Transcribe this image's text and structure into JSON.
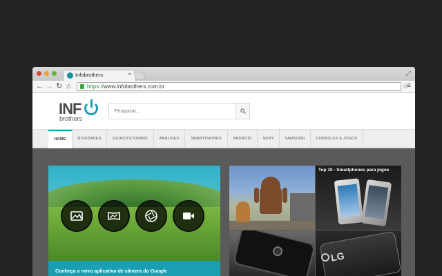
{
  "browser": {
    "tab_title": "Infobrothers",
    "tab_close": "×",
    "url_scheme": "https://",
    "url_rest": "www.infobrothers.com.br"
  },
  "site": {
    "logo_inf": "INF",
    "logo_brothers": "brothers",
    "search_placeholder": "Pesquisar..."
  },
  "nav": {
    "items": [
      {
        "label": "HOME"
      },
      {
        "label": "NOVIDADES"
      },
      {
        "label": "GUIAS/TUTORIAIS"
      },
      {
        "label": "ANÁLISES"
      },
      {
        "label": "SMARTPHONES"
      },
      {
        "label": "ANDROID"
      },
      {
        "label": "SONY"
      },
      {
        "label": "SAMSUNG"
      },
      {
        "label": "CONSOLES E JOGOS"
      }
    ]
  },
  "featured": {
    "main_caption": "Conheça o novo aplicativo de câmera do Google",
    "top10_title": "Top 10 - Smartphones para jogos",
    "lg_logo": "LG"
  },
  "colors": {
    "accent": "#1a9fb0",
    "page_bg": "#222222",
    "content_bg": "#5a5a5a"
  }
}
